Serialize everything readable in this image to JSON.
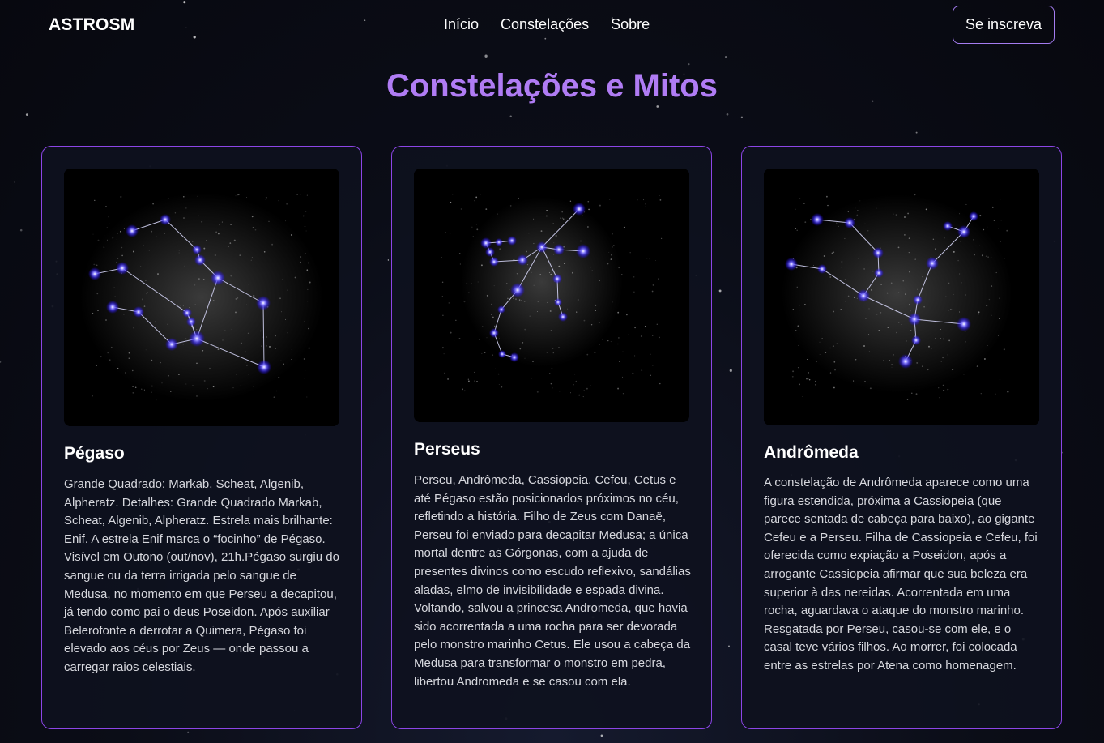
{
  "nav": {
    "brand": "ASTROSM",
    "links": [
      "Início",
      "Constelações",
      "Sobre"
    ],
    "subscribe_label": "Se inscreva"
  },
  "page_title": "Constelações e Mitos",
  "colors": {
    "accent": "#b07cf4",
    "card_border": "#8c45e6",
    "star": "#6a5cff"
  },
  "cards": [
    {
      "title": "Pégaso",
      "text": "Grande Quadrado: Markab, Scheat, Algenib, Alpheratz. Detalhes: Grande Quadrado Markab, Scheat, Algenib, Alpheratz. Estrela mais brilhante: Enif. A estrela Enif marca o “focinho” de Pégaso. Visível em Outono (out/nov), 21h.Pégaso surgiu do sangue ou da terra irrigada pelo sangue de Medusa, no momento em que Perseu a decapitou, já tendo como pai o deus Poseidon. Após auxiliar Belerofonte a derrotar a Quimera, Pégaso foi elevado aos céus por Zeus — onde passou a carregar raios celestiais.",
      "image_icon": "constellation-pegasus"
    },
    {
      "title": "Perseus",
      "text": "Perseu, Andrômeda, Cassiopeia, Cefeu, Cetus e até Pégaso estão posicionados próximos no céu, refletindo a história. Filho de Zeus com Danaë, Perseu foi enviado para decapitar Medusa; a única mortal dentre as Górgonas, com a ajuda de presentes divinos como escudo reflexivo, sandálias aladas, elmo de invisibilidade e espada divina. Voltando, salvou a princesa Andromeda, que havia sido acorrentada a uma rocha para ser devorada pelo monstro marinho Cetus. Ele usou a cabeça da Medusa para transformar o monstro em pedra, libertou Andromeda e se casou com ela.",
      "image_icon": "constellation-perseus"
    },
    {
      "title": "Andrômeda",
      "text": "A constelação de Andrômeda aparece como uma figura estendida, próxima a Cassiopeia (que parece sentada de cabeça para baixo), ao gigante Cefeu e a Perseu. Filha de Cassiopeia e Cefeu, foi oferecida como expiação a Poseidon, após a arrogante Cassiopeia afirmar que sua beleza era superior à das nereidas. Acorrentada em uma rocha, aguardava o ataque do monstro marinho. Resgatada por Perseu, casou-se com ele, e o casal teve vários filhos. Ao morrer, foi colocada entre as estrelas por Atena como homenagem.",
      "image_icon": "constellation-andromeda"
    }
  ]
}
